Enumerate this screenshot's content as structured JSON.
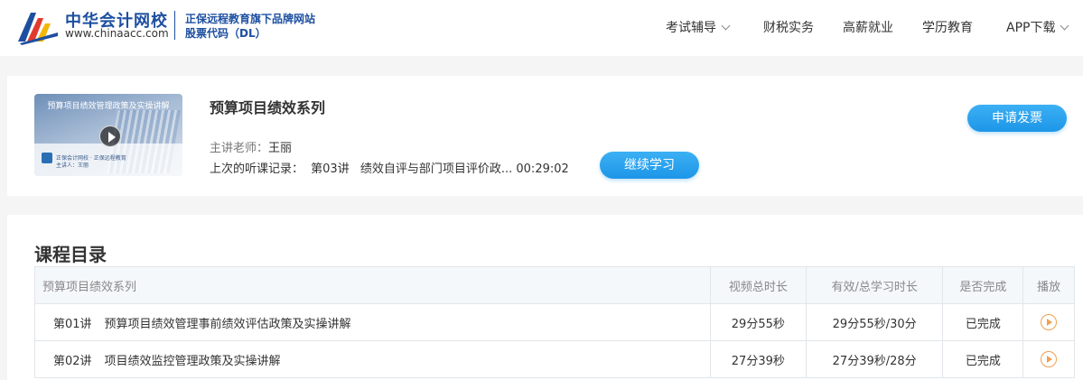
{
  "header": {
    "brand_name": "中华会计网校",
    "brand_url": "www.chinaacc.com",
    "tagline": "正保远程教育旗下品牌网站",
    "stock_code": "股票代码（DL）",
    "nav": [
      {
        "label": "考试辅导",
        "has_dropdown": true
      },
      {
        "label": "财税实务"
      },
      {
        "label": "高薪就业"
      },
      {
        "label": "学历教育"
      },
      {
        "label": "APP下载",
        "has_dropdown": true
      }
    ]
  },
  "course": {
    "thumbnail_title": "预算项目绩效管理政策及实操讲解",
    "thumbnail_sub1": "正保会计网校 · 正保远程教育",
    "thumbnail_sub2": "主讲人：王丽",
    "title": "预算项目绩效系列",
    "teacher_label": "主讲老师：",
    "teacher_name": "王丽",
    "last_record_label": "上次的听课记录：",
    "last_record_lecture": "第03讲",
    "last_record_title": "绩效自评与部门项目评价政...",
    "last_record_time": "00:29:02",
    "continue_label": "继续学习",
    "invoice_label": "申请发票"
  },
  "catalog": {
    "title": "课程目录",
    "columns": [
      "预算项目绩效系列",
      "视频总时长",
      "有效/总学习时长",
      "是否完成",
      "播放"
    ],
    "rows": [
      {
        "no": "第01讲",
        "name": "预算项目绩效管理事前绩效评估政策及实操讲解",
        "duration": "29分55秒",
        "effective": "29分55秒/30分",
        "status": "已完成"
      },
      {
        "no": "第02讲",
        "name": "项目绩效监控管理政策及实操讲解",
        "duration": "27分39秒",
        "effective": "27分39秒/28分",
        "status": "已完成"
      }
    ]
  },
  "colors": {
    "brand_blue": "#1d4fa0",
    "button_blue": "#1e96e8",
    "done_green": "#1ea43a",
    "play_orange": "#f0a050"
  }
}
